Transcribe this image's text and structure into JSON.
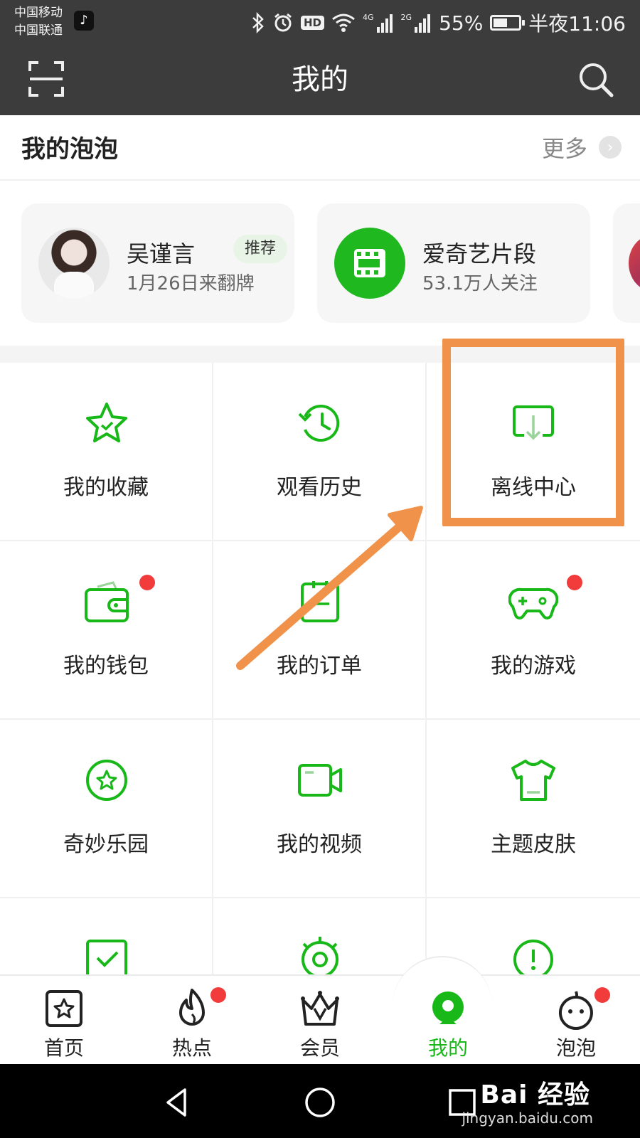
{
  "status_bar": {
    "carrier_1": "中国移动",
    "carrier_2": "中国联通",
    "hd": "HD",
    "net_1": "4G",
    "net_2": "2G",
    "battery": "55%",
    "battery_level": 0.55,
    "time": "半夜11:06"
  },
  "header": {
    "title": "我的",
    "scan_icon": "scan-icon",
    "search_icon": "search-icon"
  },
  "bubbles": {
    "title": "我的泡泡",
    "more": "更多",
    "cards": [
      {
        "name": "吴谨言",
        "tag": "推荐",
        "subtitle": "1月26日来翻牌"
      },
      {
        "name": "爱奇艺片段",
        "subtitle": "53.1万人关注"
      }
    ]
  },
  "grid": {
    "items": [
      {
        "label": "我的收藏",
        "icon": "star-icon"
      },
      {
        "label": "观看历史",
        "icon": "history-clock-icon"
      },
      {
        "label": "离线中心",
        "icon": "download-icon"
      },
      {
        "label": "我的钱包",
        "icon": "wallet-icon",
        "badge": true
      },
      {
        "label": "我的订单",
        "icon": "order-icon"
      },
      {
        "label": "我的游戏",
        "icon": "gamepad-icon",
        "badge": true
      },
      {
        "label": "奇妙乐园",
        "icon": "star-circle-icon"
      },
      {
        "label": "我的视频",
        "icon": "video-camera-icon"
      },
      {
        "label": "主题皮肤",
        "icon": "tshirt-icon"
      },
      {
        "label": "",
        "icon": "check-square-icon"
      },
      {
        "label": "",
        "icon": "settings-icon"
      },
      {
        "label": "",
        "icon": "feedback-icon"
      }
    ]
  },
  "bottom_nav": {
    "items": [
      {
        "label": "首页",
        "icon": "home-icon"
      },
      {
        "label": "热点",
        "icon": "flame-icon",
        "badge": true
      },
      {
        "label": "会员",
        "icon": "crown-icon"
      },
      {
        "label": "我的",
        "icon": "profile-icon",
        "active": true
      },
      {
        "label": "泡泡",
        "icon": "bubble-face-icon",
        "badge": true
      }
    ]
  },
  "watermark": {
    "brand": "Bai 经验",
    "url": "jingyan.baidu.com"
  },
  "colors": {
    "accent": "#18b818",
    "annotation": "#f0924a",
    "badge": "#f23c3c",
    "topbar": "#3c3c3c"
  }
}
